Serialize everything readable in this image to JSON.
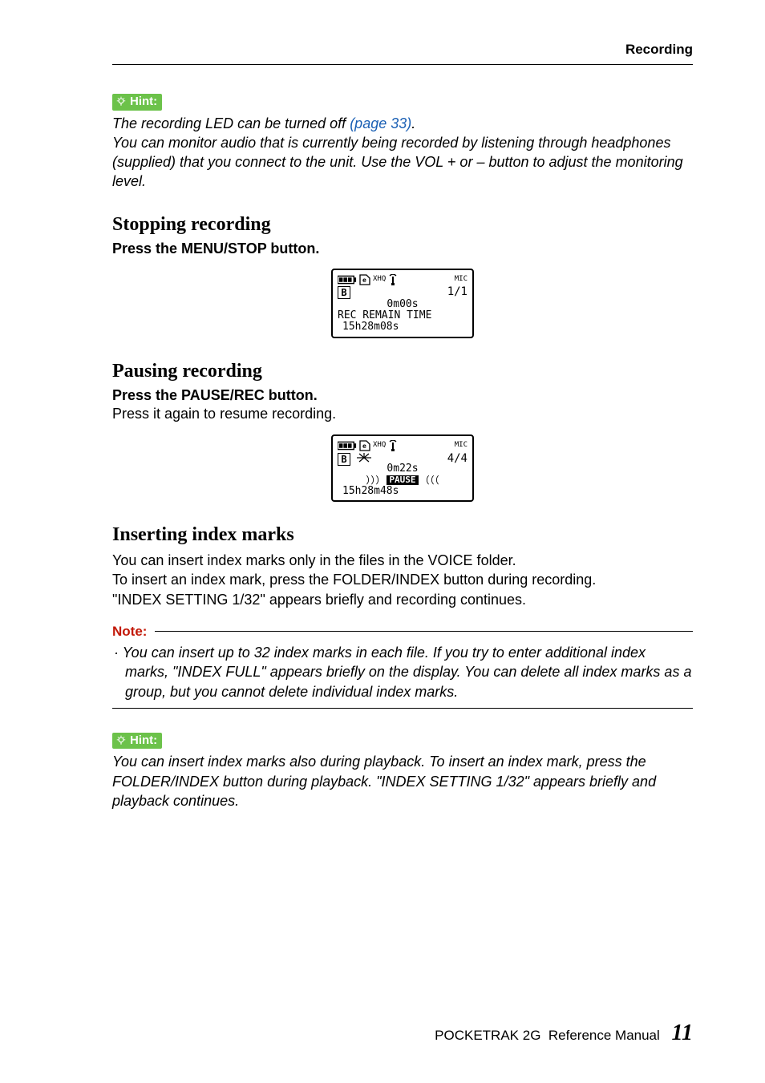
{
  "header": {
    "title": "Recording"
  },
  "hint1": {
    "label": "Hint:",
    "line1_a": "The recording LED can be turned off ",
    "line1_link": "(page 33)",
    "line1_b": ".",
    "line2": "You can monitor audio that is currently being recorded by listening through headphones (supplied) that you connect to the unit. Use the VOL + or – button to adjust the monitoring level."
  },
  "sec_stop": {
    "title": "Stopping recording",
    "instr": "Press the MENU/STOP button.",
    "lcd": {
      "top_mode": "XHQ",
      "top_mic": "MIC",
      "folder": "B",
      "count": "1/1",
      "time": "0m00s",
      "label": "REC REMAIN TIME",
      "remain": "15h28m08s"
    }
  },
  "sec_pause": {
    "title": "Pausing recording",
    "instr": "Press the PAUSE/REC button.",
    "sub": "Press it again to resume recording.",
    "lcd": {
      "top_mode": "XHQ",
      "top_mic": "MIC",
      "folder": "B",
      "count": "4/4",
      "time": "0m22s",
      "pause_left": "）））",
      "pause_label": "PAUSE",
      "pause_right": "（（（",
      "remain": "15h28m48s"
    }
  },
  "sec_index": {
    "title": "Inserting index marks",
    "p1": "You can insert index marks only in the files in the VOICE folder.",
    "p2": "To insert an index mark, press the FOLDER/INDEX button during recording.",
    "p3": "\"INDEX SETTING 1/32\" appears briefly and recording continues."
  },
  "note": {
    "label": "Note:",
    "body": "· You can insert up to 32 index marks in each file. If you try to enter additional index marks, \"INDEX FULL\" appears briefly on the display. You can delete all index marks as a group, but you cannot delete individual index marks."
  },
  "hint2": {
    "label": "Hint:",
    "body": "You can insert index marks also during playback. To insert an index mark, press the FOLDER/INDEX button during playback. \"INDEX SETTING 1/32\" appears briefly and playback continues."
  },
  "footer": {
    "product": "POCKETRAK 2G",
    "doc": "Reference Manual",
    "page": "11"
  }
}
